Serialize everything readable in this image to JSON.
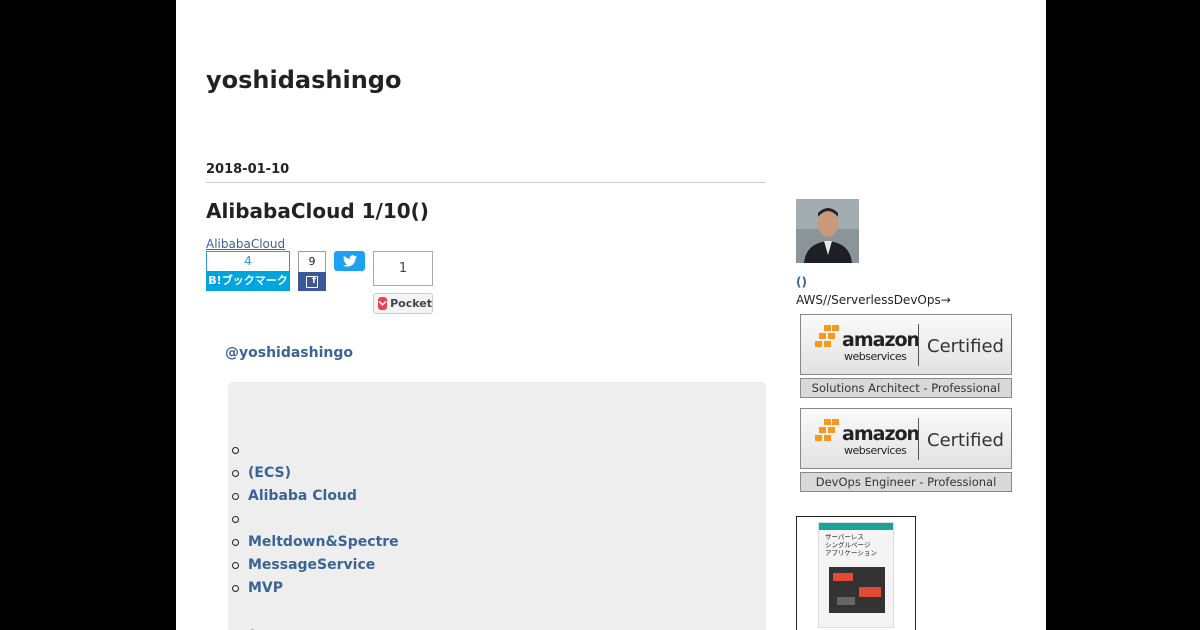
{
  "blog": {
    "title": "yoshidashingo"
  },
  "entry": {
    "date": "2018-01-10",
    "title": "AlibabaCloud 1/10()",
    "category": "AlibabaCloud",
    "author": "@yoshidashingo"
  },
  "share": {
    "hatena_count": "4",
    "hatena_label": "B!ブックマーク",
    "facebook_count": "9",
    "facebook_glyph": "f",
    "pocket_count": "1",
    "pocket_label": "Pocket"
  },
  "toc": {
    "items": [
      "",
      "(ECS)",
      "Alibaba Cloud",
      "",
      "Meltdown&Spectre",
      " MessageService",
      "MVP"
    ],
    "partial_item": "◦ ..."
  },
  "sidebar": {
    "profile_name": "()",
    "profile_desc": "AWS//ServerlessDevOps→",
    "certs": [
      {
        "amazon": "amazon",
        "ws": "webservices",
        "certified": "Certified",
        "label": "Solutions Architect - Professional"
      },
      {
        "amazon": "amazon",
        "ws": "webservices",
        "certified": "Certified",
        "label": "DevOps Engineer - Professional"
      }
    ],
    "book_title": "サーバーレス\nシングルページ\nアプリケーション"
  },
  "colors": {
    "link": "#3b6496",
    "hatena": "#00a4de",
    "facebook": "#3b5998",
    "twitter": "#1da1f2",
    "pocket": "#ef4056"
  }
}
